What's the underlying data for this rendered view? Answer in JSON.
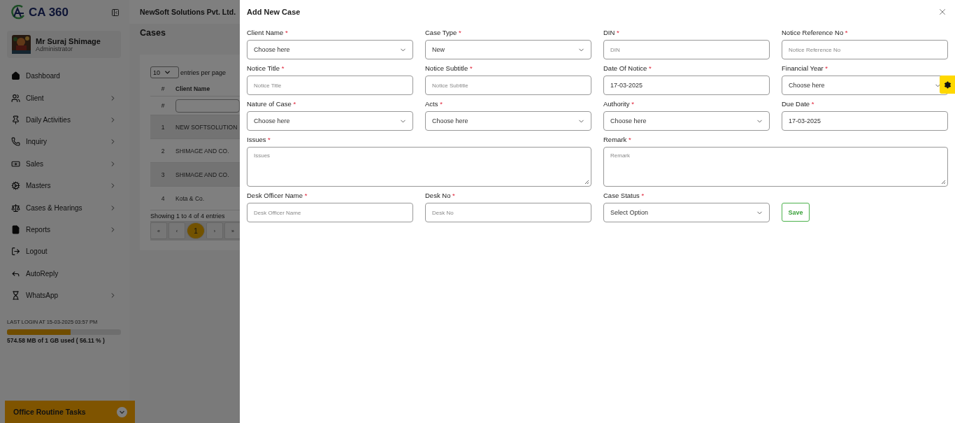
{
  "sidebar": {
    "logo": "CA 360",
    "user": {
      "name": "Mr Suraj Shimage",
      "role": "Administrator"
    },
    "items": [
      {
        "label": "Dashboard",
        "has_children": false
      },
      {
        "label": "Client",
        "has_children": true
      },
      {
        "label": "Daily Activities",
        "has_children": true
      },
      {
        "label": "Inquiry",
        "has_children": true
      },
      {
        "label": "Sales",
        "has_children": true
      },
      {
        "label": "Masters",
        "has_children": true
      },
      {
        "label": "Cases & Hearings",
        "has_children": true
      },
      {
        "label": "Reports",
        "has_children": true
      },
      {
        "label": "Logout",
        "has_children": false
      },
      {
        "label": "AutoReply",
        "has_children": false
      },
      {
        "label": "WhatsApp",
        "has_children": true
      }
    ],
    "last_login": "LAST LOGIN AT 15-03-2025 03:57 PM",
    "storage": {
      "level": 0.5611,
      "text": "574.58 MB of 1 GB used ( 56.11 % )"
    },
    "tasks_bar": "Office Routine Tasks"
  },
  "header": {
    "company": "NewSoft Solutions Pvt. Ltd."
  },
  "page": {
    "title": "Cases",
    "page_size": "10",
    "page_size_label": "entries per page",
    "columns": [
      "#",
      "Client Name"
    ],
    "filter_mark": "#",
    "rows": [
      [
        "1",
        "NEW SOFTSOLUTION"
      ],
      [
        "2",
        "SHIMAGE AND CO."
      ],
      [
        "3",
        "SHIMAGE AND CO."
      ],
      [
        "4",
        "Kota & Co."
      ]
    ],
    "showing": "Showing 1 to 4 of 4 entries",
    "pages": [
      {
        "label": "«",
        "selected": false
      },
      {
        "label": "‹",
        "selected": false
      },
      {
        "label": "1",
        "selected": true
      },
      {
        "label": "›",
        "selected": false
      },
      {
        "label": "»",
        "selected": false
      }
    ]
  },
  "modal": {
    "title": "Add New Case",
    "fields": [
      {
        "label": "Client Name",
        "required_mark": "*",
        "kind": "select",
        "value": "Choose here"
      },
      {
        "label": "Case Type",
        "required_mark": "*",
        "kind": "select",
        "value": "New"
      },
      {
        "label": "DIN",
        "required_mark": "*",
        "kind": "input",
        "placeholder": "DIN"
      },
      {
        "label": "Notice Reference No",
        "required_mark": "*",
        "kind": "input",
        "placeholder": "Notice Reference No"
      },
      {
        "label": "Notice Title",
        "required_mark": "*",
        "kind": "input",
        "placeholder": "Notice Title"
      },
      {
        "label": "Notice Subtitle",
        "required_mark": "*",
        "kind": "input",
        "placeholder": "Notice Subtitle"
      },
      {
        "label": "Date Of Notice",
        "required_mark": "*",
        "kind": "input",
        "value": "17-03-2025"
      },
      {
        "label": "Financial Year",
        "required_mark": "*",
        "kind": "select",
        "value": "Choose here"
      },
      {
        "label": "Nature of Case",
        "required_mark": "*",
        "kind": "select",
        "value": "Choose here"
      },
      {
        "label": "Acts",
        "required_mark": "*",
        "kind": "select",
        "value": "Choose here"
      },
      {
        "label": "Authority",
        "required_mark": "*",
        "kind": "select",
        "value": "Choose here"
      },
      {
        "label": "Due Date",
        "required_mark": "*",
        "kind": "input",
        "value": "17-03-2025"
      },
      {
        "label": "Issues",
        "required_mark": "*",
        "kind": "textarea",
        "placeholder": "Issues"
      },
      {
        "label": "Remark",
        "required_mark": "*",
        "kind": "textarea",
        "placeholder": "Remark"
      },
      {
        "label": "Desk Officer Name",
        "required_mark": "*",
        "kind": "input",
        "placeholder": "Desk Officer Name"
      },
      {
        "label": "Desk No",
        "required_mark": "*",
        "kind": "input",
        "placeholder": "Desk No"
      },
      {
        "label": "Case Status",
        "required_mark": "*",
        "kind": "select",
        "value": "Select Option"
      }
    ],
    "save": "Save"
  }
}
